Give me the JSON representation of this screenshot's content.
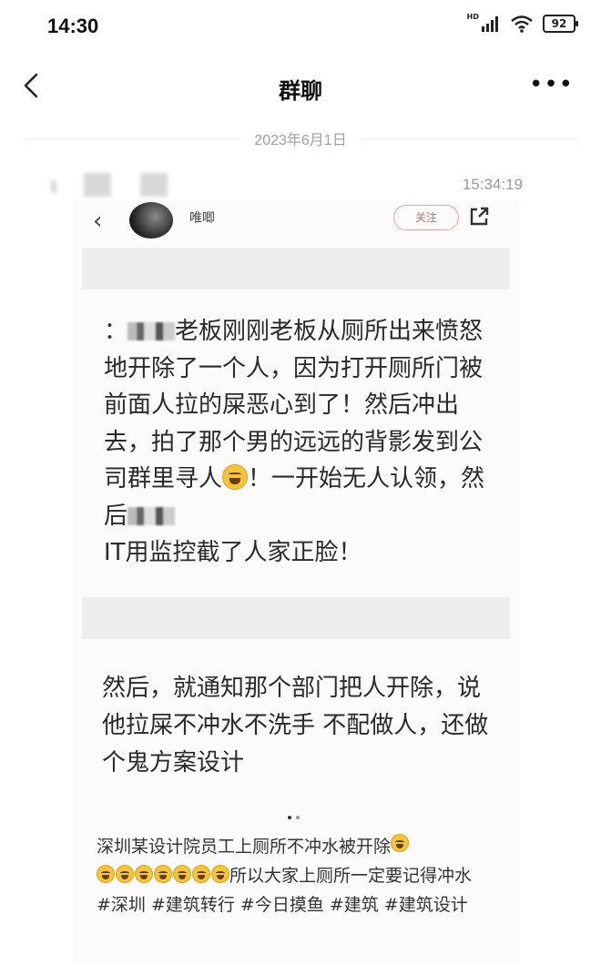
{
  "status_bar": {
    "time": "14:30",
    "network": "HD",
    "battery": "92"
  },
  "nav": {
    "title": "群聊",
    "back_icon": "chevron-left-icon",
    "more_icon": "more-horizontal-icon"
  },
  "chat": {
    "date_divider": "2023年6月1日",
    "message_time": "15:34:19"
  },
  "shared_image": {
    "username": "唯唧",
    "follow_label": "关注",
    "paragraph1_a": "：",
    "paragraph1_b": "老板刚刚老板从厕所出来愤怒地开除了一个人，因为打开厕所门被前面人拉的屎恶心到了！然后冲出去，拍了那个男的远远的背影发到公司群里寻人",
    "paragraph1_c": "！一开始无人认领，然后",
    "paragraph1_d": "IT用监控截了人家正脸！",
    "paragraph2": "然后，就通知那个部门把人开除，说他拉屎不冲水不洗手 不配做人，还做个鬼方案设计",
    "caption_line1": "深圳某设计院员工上厕所不冲水被开除",
    "caption_line2": "所以大家上厕所一定要记得冲水",
    "hashtags": "#深圳 #建筑转行 #今日摸鱼 #建筑 #建筑设计"
  },
  "colors": {
    "background": "#ffffff",
    "divider_text": "#a0a0a0",
    "follow_accent": "#b76e6e"
  }
}
